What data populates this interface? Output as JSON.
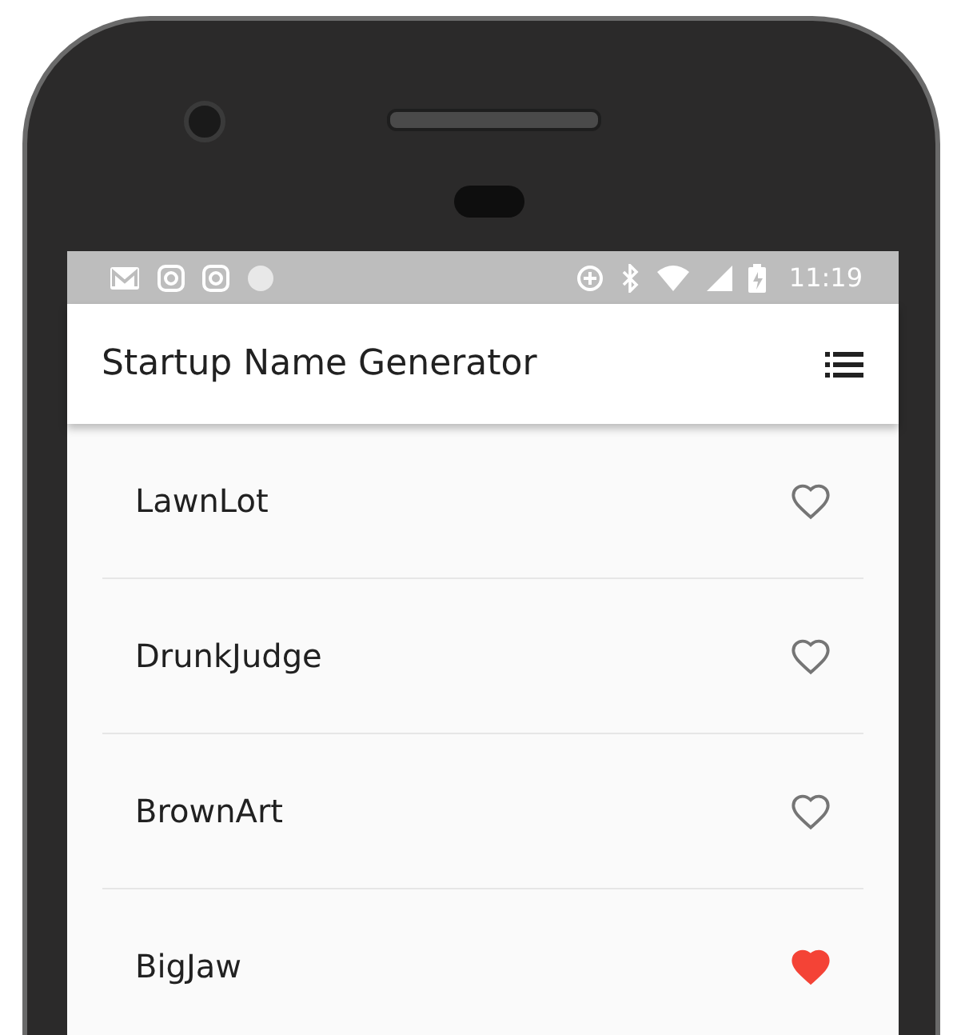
{
  "status_bar": {
    "time": "11:19"
  },
  "app_bar": {
    "title": "Startup Name Generator"
  },
  "items": [
    {
      "name": "LawnLot",
      "favorite": false
    },
    {
      "name": "DrunkJudge",
      "favorite": false
    },
    {
      "name": "BrownArt",
      "favorite": false
    },
    {
      "name": "BigJaw",
      "favorite": true
    }
  ]
}
